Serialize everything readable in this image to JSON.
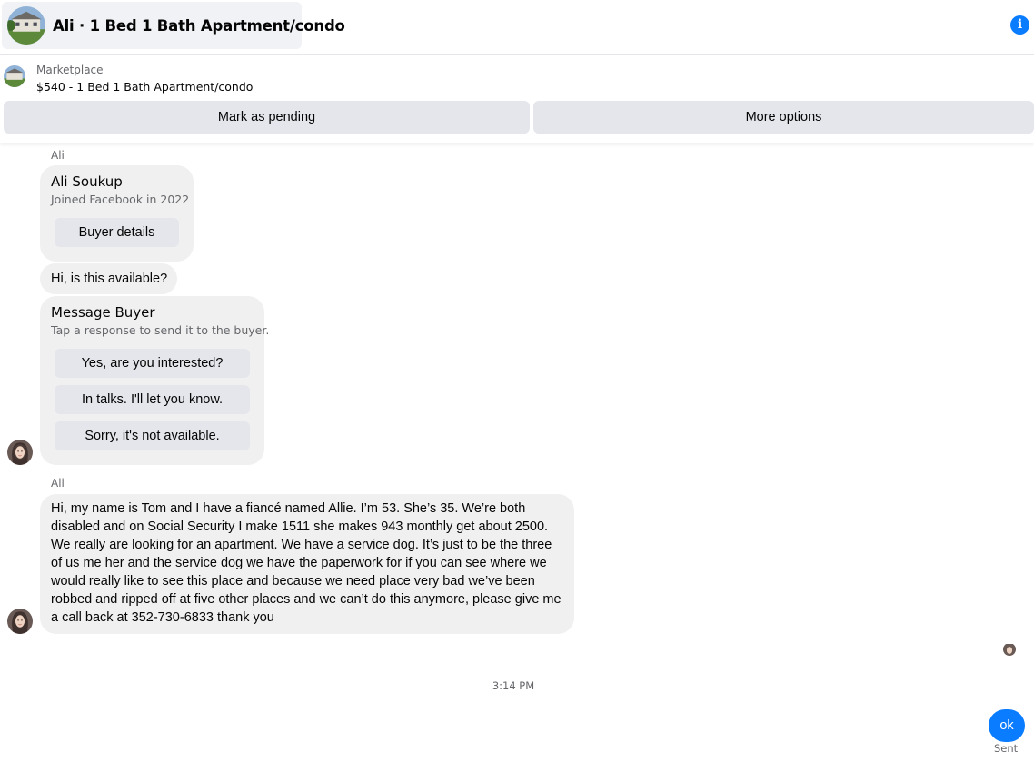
{
  "header": {
    "title": "Ali · 1 Bed 1 Bath Apartment/condo",
    "info_icon": "info-icon",
    "info_glyph": "i"
  },
  "listing": {
    "category": "Marketplace",
    "name": "$540 - 1 Bed 1 Bath Apartment/condo",
    "mark_pending_label": "Mark as pending",
    "more_options_label": "More options"
  },
  "thread": {
    "sender_1": "Ali",
    "buyer_card": {
      "name": "Ali Soukup",
      "joined": "Joined Facebook in 2022",
      "button": "Buyer details"
    },
    "first_message": "Hi, is this available?",
    "message_buyer_card": {
      "title": "Message Buyer",
      "subtitle": "Tap a response to send it to the buyer.",
      "responses": [
        "Yes, are you interested?",
        "In talks. I'll let you know.",
        "Sorry, it's not available."
      ]
    },
    "sender_2": "Ali",
    "long_message": "Hi, my name is Tom and I have a fiancé named Allie. I’m 53. She’s 35. We’re both disabled and on Social Security I make 1511 she makes 943 monthly get about 2500. We really are looking for an apartment. We have a service dog. It’s just to be the three of us me her and the service dog we have the paperwork for if you can see where we would really like to see this place and because we need place very bad we’ve been robbed and ripped off at five other places and we can’t do this anymore, please give me a call back at 352-730-6833 thank you",
    "timestamp": "3:14 PM",
    "my_reply": "ok",
    "status": "Sent"
  },
  "colors": {
    "accent": "#0a7cff",
    "bubble_bg": "#f0f0f0",
    "button_bg": "#e4e6eb",
    "secondary_text": "#65676b"
  }
}
